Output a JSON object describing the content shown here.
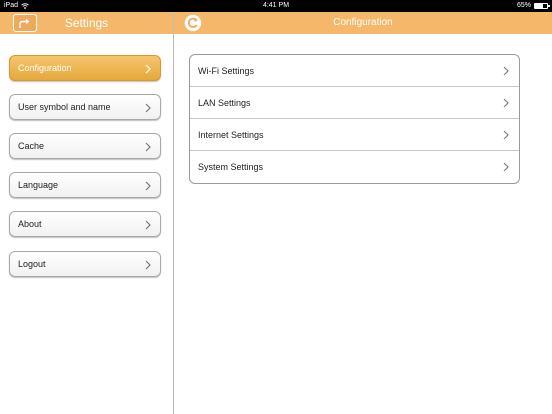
{
  "status_bar": {
    "device": "iPad",
    "time": "4:41 PM",
    "battery_text": "65%",
    "battery_level": 0.65
  },
  "left_nav": {
    "title": "Settings",
    "share_icon": "share-arrow-icon"
  },
  "right_nav": {
    "title": "Configuration",
    "refresh_icon": "refresh-icon"
  },
  "sidebar": {
    "items": [
      {
        "label": "Configuration",
        "active": true
      },
      {
        "label": "User symbol and name",
        "active": false
      },
      {
        "label": "Cache",
        "active": false
      },
      {
        "label": "Language",
        "active": false
      },
      {
        "label": "About",
        "active": false
      },
      {
        "label": "Logout",
        "active": false
      }
    ]
  },
  "config_list": {
    "items": [
      {
        "label": "Wi-Fi Settings"
      },
      {
        "label": "LAN Settings"
      },
      {
        "label": "Internet Settings"
      },
      {
        "label": "System Settings"
      }
    ]
  },
  "colors": {
    "accent": "#f5b86b",
    "active_item": "#e6a83a"
  }
}
